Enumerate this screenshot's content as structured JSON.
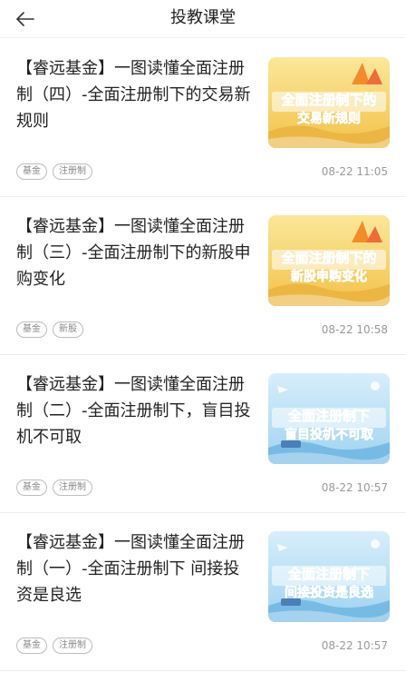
{
  "header": {
    "title": "投教课堂",
    "back_icon": "arrow-left-icon"
  },
  "articles": [
    {
      "title": "【睿远基金】一图读懂全面注册制（四）-全面注册制下的交易新规则",
      "thumb_line1": "全面注册制下的",
      "thumb_line2": "交易新规则",
      "thumb_theme": "yellow",
      "tags": [
        "基金",
        "注册制"
      ],
      "time": "08-22 11:05"
    },
    {
      "title": "【睿远基金】一图读懂全面注册制（三）-全面注册制下的新股申购变化",
      "thumb_line1": "全面注册制下的",
      "thumb_line2": "新股申购变化",
      "thumb_theme": "yellow",
      "tags": [
        "基金",
        "新股"
      ],
      "time": "08-22 10:58"
    },
    {
      "title": "【睿远基金】一图读懂全面注册制（二）-全面注册制下，盲目投机不可取",
      "thumb_line1": "全面注册制下",
      "thumb_line2": "盲目投机不可取",
      "thumb_theme": "blue",
      "tags": [
        "基金",
        "注册制"
      ],
      "time": "08-22 10:57"
    },
    {
      "title": "【睿远基金】一图读懂全面注册制（一）-全面注册制下 间接投资是良选",
      "thumb_line1": "全面注册制下",
      "thumb_line2": "间接投资是良选",
      "thumb_theme": "blue",
      "tags": [
        "基金",
        "注册制"
      ],
      "time": "08-22 10:57"
    }
  ],
  "colors": {
    "thumb_text": "#1b6fd6",
    "thumb_yellow_bg": "#f6d66a",
    "thumb_blue_bg": "#bfe3f7",
    "divider": "#eeeeee"
  }
}
